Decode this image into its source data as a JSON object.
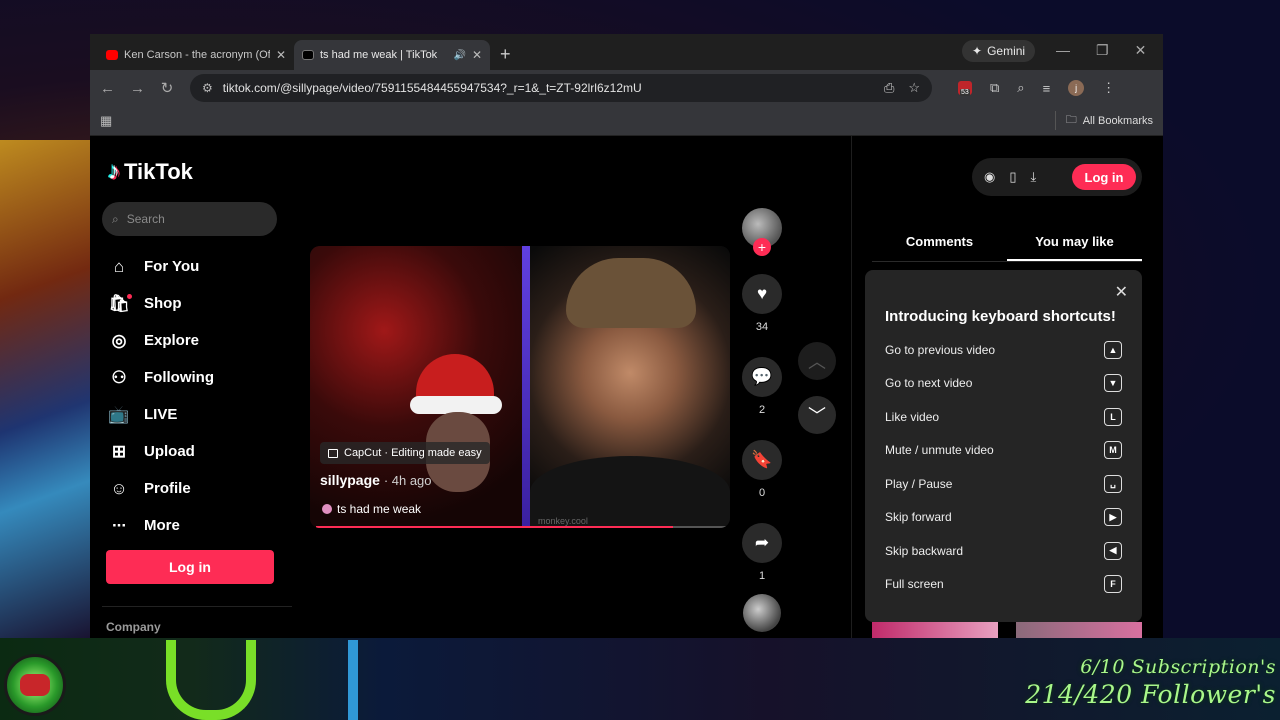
{
  "browser": {
    "tabs": [
      {
        "title": "Ken Carson - the acronym (Offi",
        "active": false,
        "icon": "youtube-icon"
      },
      {
        "title": "ts had me weak | TikTok",
        "active": true,
        "icon": "tiktok-icon"
      }
    ],
    "gemini_label": "Gemini",
    "url": "tiktok.com/@sillypage/video/7591155484455947534?_r=1&_t=ZT-92lrl6z12mU",
    "extension_badge": "53",
    "profile_initial": "j",
    "bookmarks_label": "All Bookmarks"
  },
  "tiktok": {
    "logo_text": "TikTok",
    "search_placeholder": "Search",
    "nav": [
      {
        "label": "For You",
        "icon": "home-icon"
      },
      {
        "label": "Shop",
        "icon": "shop-icon"
      },
      {
        "label": "Explore",
        "icon": "compass-icon"
      },
      {
        "label": "Following",
        "icon": "following-icon"
      },
      {
        "label": "LIVE",
        "icon": "live-icon"
      },
      {
        "label": "Upload",
        "icon": "upload-icon"
      },
      {
        "label": "Profile",
        "icon": "profile-icon"
      },
      {
        "label": "More",
        "icon": "more-icon"
      }
    ],
    "login_label": "Log in",
    "company_label": "Company",
    "video": {
      "capcut_label": "CapCut · Editing made easy",
      "author": "sillypage",
      "time": "· 4h ago",
      "caption": "ts had me weak",
      "watermark": "monkey.cool",
      "progress": 0.87
    },
    "actions": {
      "likes": "34",
      "comments": "2",
      "saves": "0",
      "shares": "1"
    },
    "right_panel": {
      "login_label": "Log in",
      "tabs": [
        "Comments",
        "You may like"
      ],
      "active_tab": 1
    },
    "shortcuts": {
      "title": "Introducing keyboard shortcuts!",
      "items": [
        {
          "label": "Go to previous video",
          "key": "▲"
        },
        {
          "label": "Go to next video",
          "key": "▼"
        },
        {
          "label": "Like video",
          "key": "L"
        },
        {
          "label": "Mute / unmute video",
          "key": "M"
        },
        {
          "label": "Play / Pause",
          "key": "␣"
        },
        {
          "label": "Skip forward",
          "key": "▶"
        },
        {
          "label": "Skip backward",
          "key": "◀"
        },
        {
          "label": "Full screen",
          "key": "F"
        }
      ]
    }
  },
  "overlay": {
    "subscriptions": "6/10 Subscription's",
    "followers": "214/420 Follower's"
  },
  "colors": {
    "tiktok_accent": "#fe2c55",
    "stats_text": "#a9f78a"
  }
}
